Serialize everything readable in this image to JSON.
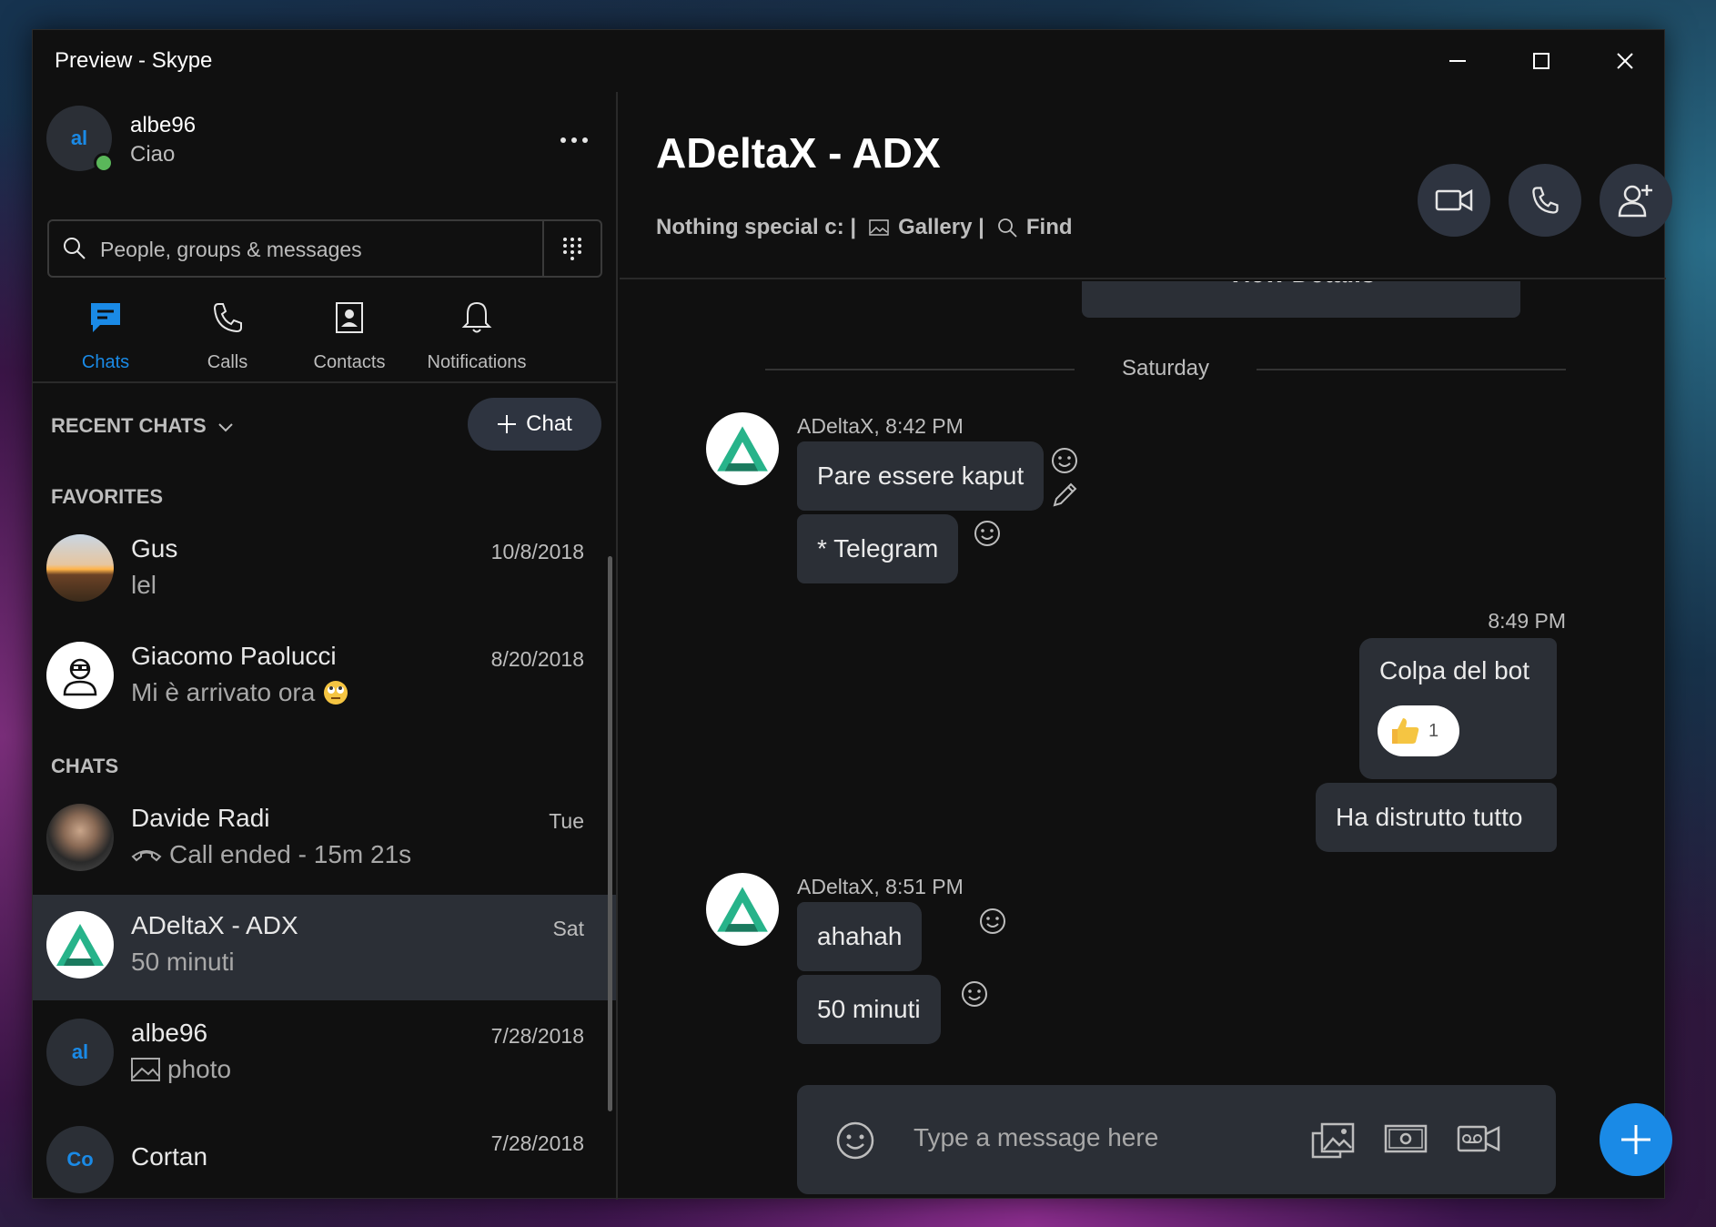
{
  "window": {
    "title": "Preview - Skype"
  },
  "profile": {
    "initials": "al",
    "name": "albe96",
    "mood": "Ciao"
  },
  "search": {
    "placeholder": "People, groups & messages"
  },
  "nav": {
    "tabs": [
      {
        "label": "Chats",
        "active": true
      },
      {
        "label": "Calls",
        "active": false
      },
      {
        "label": "Contacts",
        "active": false
      },
      {
        "label": "Notifications",
        "active": false
      }
    ]
  },
  "sidebar": {
    "recent_label": "RECENT CHATS",
    "new_chat_label": "Chat",
    "favorites_label": "FAVORITES",
    "chats_label": "CHATS",
    "favorites": [
      {
        "name": "Gus",
        "preview": "lel",
        "date": "10/8/2018"
      },
      {
        "name": "Giacomo Paolucci",
        "preview": "Mi è arrivato ora",
        "date": "8/20/2018"
      }
    ],
    "chats": [
      {
        "name": "Davide Radi",
        "preview": "Call ended - 15m 21s",
        "date": "Tue"
      },
      {
        "name": "ADeltaX - ADX",
        "preview": "50 minuti",
        "date": "Sat",
        "selected": true
      },
      {
        "name": "albe96",
        "initials": "al",
        "preview": "photo",
        "date": "7/28/2018"
      },
      {
        "name": "Cortan",
        "initials": "Co",
        "preview": "",
        "date": "7/28/2018"
      }
    ]
  },
  "conversation": {
    "title": "ADeltaX - ADX",
    "subtitle_mood": "Nothing special c: |",
    "gallery_label": "Gallery |",
    "find_label": "Find",
    "view_details_label": "View Details",
    "day_label": "Saturday",
    "messages": [
      {
        "sender": "ADeltaX, 8:42 PM",
        "text": "Pare essere kaput"
      },
      {
        "text": "* Telegram"
      },
      {
        "time": "8:49 PM",
        "text": "Colpa del bot",
        "reaction_count": "1"
      },
      {
        "text": "Ha distrutto tutto"
      },
      {
        "sender": "ADeltaX, 8:51 PM",
        "text": "ahahah"
      },
      {
        "text": "50 minuti"
      }
    ],
    "composer_placeholder": "Type a message here"
  },
  "colors": {
    "accent": "#1a8ae6",
    "online": "#5ab75a",
    "bubble": "#2b2f36",
    "background": "#101010",
    "adx_green": "#27b38a"
  }
}
